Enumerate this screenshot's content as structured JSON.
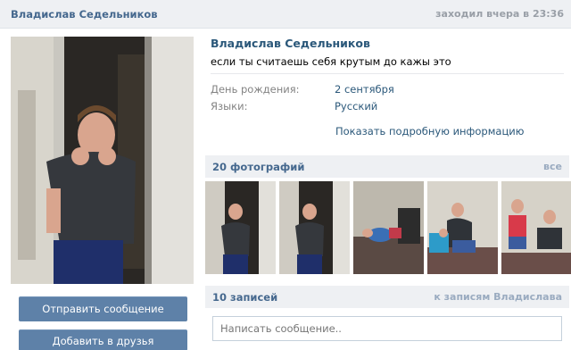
{
  "header": {
    "name": "Владислав Седельников",
    "last_seen": "заходил вчера в 23:36"
  },
  "profile": {
    "name": "Владислав Седельников",
    "status": "если ты считаешь себя крутым до кажы это",
    "info": [
      {
        "label": "День рождения:",
        "value": "2 сентября"
      },
      {
        "label": "Языки:",
        "value": "Русский"
      }
    ],
    "show_more": "Показать подробную информацию"
  },
  "actions": {
    "send_message": "Отправить сообщение",
    "add_friend": "Добавить в друзья"
  },
  "photos": {
    "title": "20 фотографий",
    "link": "все",
    "count": 5
  },
  "posts": {
    "title": "10 записей",
    "link": "к записям Владислава",
    "compose_placeholder": "Написать сообщение.."
  },
  "colors": {
    "accent": "#5e81a8",
    "link": "#2b587a",
    "header_bg": "#eef0f3"
  }
}
